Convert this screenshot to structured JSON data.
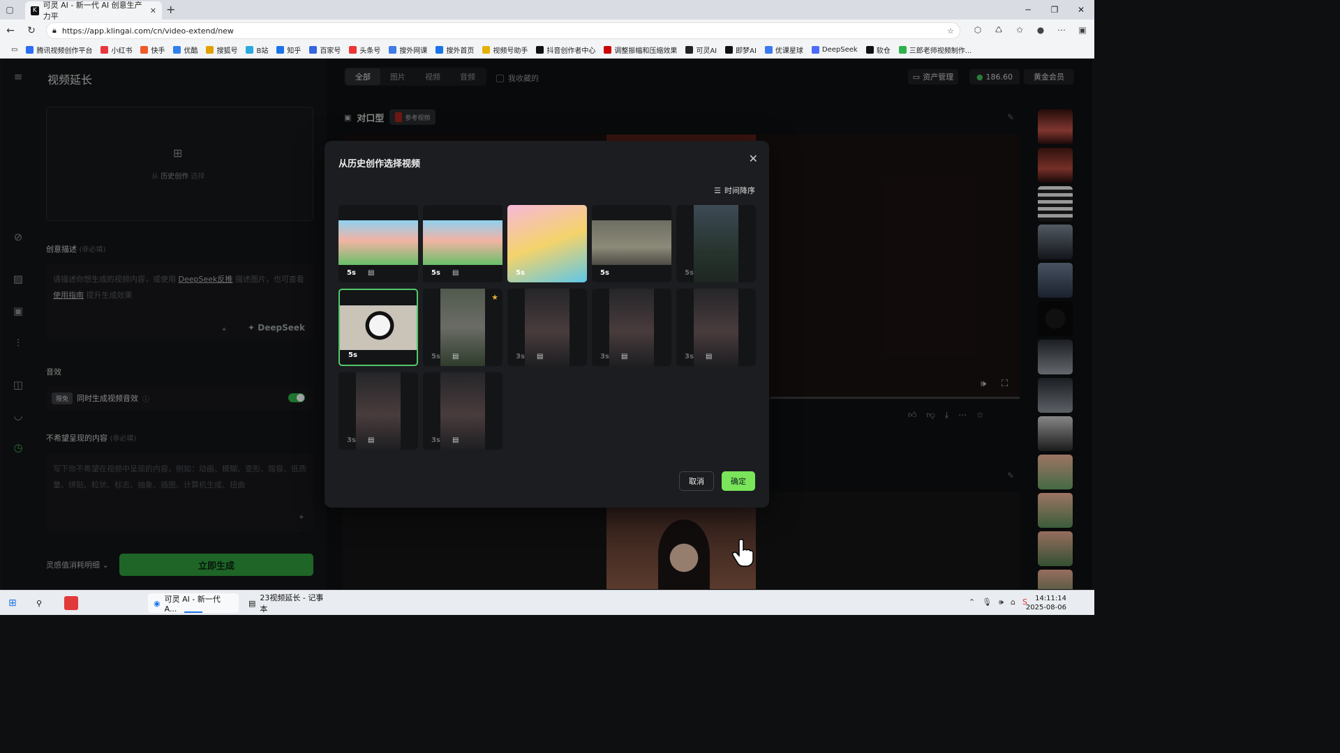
{
  "browser": {
    "tab_title": "可灵 AI - 新一代 AI 创意生产力平",
    "url": "https://app.klingai.com/cn/video-extend/new",
    "bookmarks": [
      "腾讯视频创作平台",
      "小红书",
      "快手",
      "优酷",
      "搜狐号",
      "B站",
      "知乎",
      "百家号",
      "头条号",
      "搜外网课",
      "搜外首页",
      "视频号助手",
      "抖音创作者中心",
      "调整振幅和压缩效果",
      "可灵AI",
      "即梦AI",
      "优课星球",
      "DeepSeek",
      "软仓",
      "三郎老师视频制作..."
    ]
  },
  "sidebar": {
    "title": "视频延长",
    "upload_text": "历史创作",
    "upload_suffix": "选择",
    "upload_prefix": "从",
    "desc_label": "创意描述",
    "desc_optional": "(非必填)",
    "desc_placeholder_1": "请描述你想生成的视频内容，或使用",
    "desc_link1": "DeepSeek反推",
    "desc_placeholder_2": "描述图片，也可查看",
    "desc_link2": "使用指南",
    "desc_placeholder_3": "提升生成效果",
    "deepseek_label": "DeepSeek",
    "sfx_label": "音效",
    "sfx_badge": "限免",
    "sfx_text": "同时生成视频音效",
    "neg_label": "不希望呈现的内容",
    "neg_optional": "(非必填)",
    "neg_placeholder": "写下你不希望在视频中呈现的内容，例如：动画、模糊、变形、毁容、低质量、拼贴、粒状、标志、抽象、插图、计算机生成、扭曲",
    "cost_label": "灵感值消耗明细",
    "generate_button": "立即生成"
  },
  "topbar": {
    "filters": [
      "全部",
      "图片",
      "视频",
      "音频"
    ],
    "active_filter": 0,
    "favorites_label": "我收藏的",
    "assets_button": "资产管理",
    "credits": "186.60",
    "member_button": "黄金会员"
  },
  "card": {
    "title": "对口型",
    "ref_label": "参考视频"
  },
  "modal": {
    "title": "从历史创作选择视频",
    "sort_label": "时间降序",
    "cancel": "取消",
    "confirm": "确定",
    "items": [
      {
        "dur": "5s",
        "faded": false,
        "selected": false,
        "star": false,
        "icon": true
      },
      {
        "dur": "5s",
        "faded": false,
        "selected": false,
        "star": false,
        "icon": true
      },
      {
        "dur": "5s",
        "faded": false,
        "selected": false,
        "star": false,
        "icon": false
      },
      {
        "dur": "5s",
        "faded": false,
        "selected": false,
        "star": false,
        "icon": false
      },
      {
        "dur": "5s",
        "faded": true,
        "selected": false,
        "star": false,
        "icon": false
      },
      {
        "dur": "5s",
        "faded": false,
        "selected": true,
        "star": false,
        "icon": false
      },
      {
        "dur": "5s",
        "faded": true,
        "selected": false,
        "star": true,
        "icon": true
      },
      {
        "dur": "3s",
        "faded": true,
        "selected": false,
        "star": false,
        "icon": true
      },
      {
        "dur": "3s",
        "faded": true,
        "selected": false,
        "star": false,
        "icon": true
      },
      {
        "dur": "3s",
        "faded": true,
        "selected": false,
        "star": false,
        "icon": true
      },
      {
        "dur": "3s",
        "faded": true,
        "selected": false,
        "star": false,
        "icon": true
      }
    ]
  },
  "taskbar": {
    "item1": "可灵 AI - 新一代 A...",
    "item2": "23视频延长 - 记事本",
    "time": "14:11:14",
    "date": "2025-08-06"
  },
  "colors": {
    "accent_green": "#7ae45a",
    "generate_green": "#2e9c3c",
    "selected_border": "#52c96a"
  }
}
